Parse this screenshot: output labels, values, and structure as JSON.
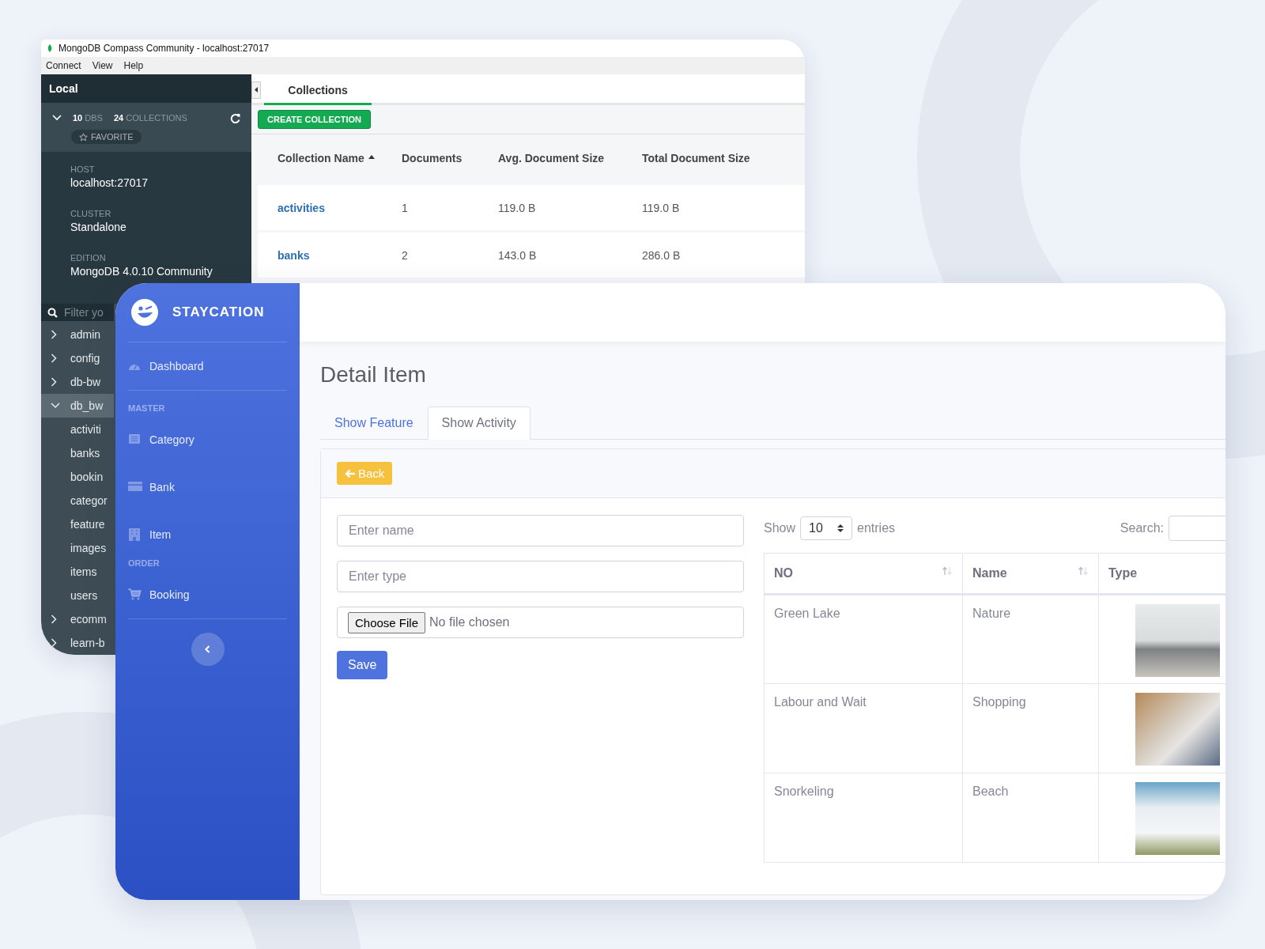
{
  "mongo_window": {
    "title": "MongoDB Compass Community - localhost:27017",
    "menu": [
      "Connect",
      "View",
      "Help"
    ],
    "sidebar": {
      "header": "Local",
      "dbs": "**10** DBS",
      "collections": "**24** COLLECTIONS",
      "favorite": "FAVORITE",
      "info": [
        {
          "label": "HOST",
          "value": "localhost:27017"
        },
        {
          "label": "CLUSTER",
          "value": "Standalone"
        },
        {
          "label": "EDITION",
          "value": "MongoDB 4.0.10 Community"
        }
      ],
      "filter_placeholder": "Filter yo",
      "databases": [
        {
          "name": "admin",
          "expanded": false,
          "selected": false
        },
        {
          "name": "config",
          "expanded": false,
          "selected": false
        },
        {
          "name": "db-bw",
          "expanded": false,
          "selected": false
        },
        {
          "name": "db_bw",
          "expanded": true,
          "selected": true,
          "children": [
            {
              "name": "activiti"
            },
            {
              "name": "banks"
            },
            {
              "name": "bookin"
            },
            {
              "name": "categor"
            },
            {
              "name": "feature"
            },
            {
              "name": "images"
            },
            {
              "name": "items"
            },
            {
              "name": "users"
            }
          ]
        },
        {
          "name": "ecomm",
          "expanded": false,
          "selected": false
        },
        {
          "name": "learn-b",
          "expanded": false,
          "selected": false
        }
      ]
    },
    "tabs": [
      {
        "label": "Collections",
        "selected": true
      }
    ],
    "create_button": "CREATE COLLECTION",
    "table": {
      "columns": [
        {
          "label": "Collection Name",
          "sorted": true
        },
        {
          "label": "Documents",
          "sorted": false
        },
        {
          "label": "Avg. Document Size",
          "sorted": false
        },
        {
          "label": "Total Document Size",
          "sorted": false
        }
      ],
      "rows": [
        [
          "activities",
          "1",
          "119.0 B",
          "119.0 B"
        ],
        [
          "banks",
          "2",
          "143.0 B",
          "286.0 B"
        ]
      ]
    }
  },
  "staycation_window": {
    "brand": "STAYCATION",
    "nav": [
      {
        "kind": "link",
        "label": "Dashboard"
      },
      {
        "kind": "divider"
      },
      {
        "kind": "heading",
        "label": "MASTER"
      },
      {
        "kind": "link",
        "label": "Category"
      },
      {
        "kind": "link",
        "label": "Bank"
      },
      {
        "kind": "link",
        "label": "Item"
      },
      {
        "kind": "heading",
        "label": "ORDER"
      },
      {
        "kind": "link",
        "label": "Booking"
      },
      {
        "kind": "divider"
      }
    ],
    "page_title": "Detail Item",
    "tabs": [
      {
        "label": "Show Feature",
        "selected": false
      },
      {
        "label": "Show Activity",
        "selected": true
      }
    ],
    "back_button": "Back",
    "form": {
      "fields": [
        {
          "placeholder": "Enter name"
        },
        {
          "placeholder": "Enter type"
        }
      ],
      "file_button": "Choose File",
      "file_status": "No file chosen",
      "save_button": "Save"
    },
    "table_controls": {
      "show_label": "Show",
      "page_size": "10",
      "entries_label": "entries",
      "search_label": "Search:"
    },
    "table": {
      "columns": [
        "NO",
        "Name",
        "Type"
      ],
      "rows": [
        {
          "cells": [
            "Green Lake",
            "Nature"
          ]
        },
        {
          "cells": [
            "Labour and Wait",
            "Shopping"
          ]
        },
        {
          "cells": [
            "Snorkeling",
            "Beach"
          ]
        }
      ]
    }
  }
}
